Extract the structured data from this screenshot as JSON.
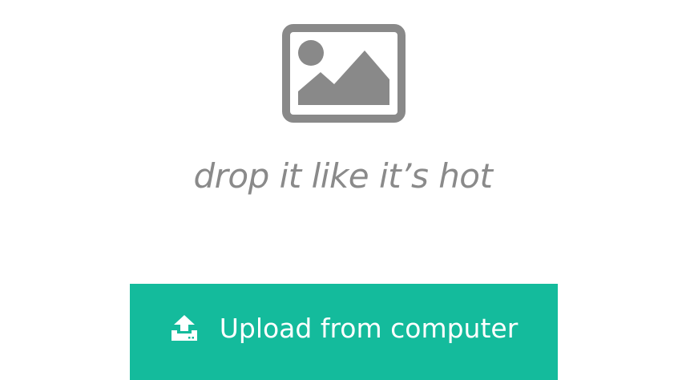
{
  "dropzone": {
    "icon": "image-placeholder-icon",
    "text": "drop it like it’s hot",
    "text_color": "#8a8a8a",
    "icon_color": "#898989"
  },
  "upload_button": {
    "label": "Upload from computer",
    "icon": "upload-icon",
    "background": "#14bb9c",
    "text_color": "#ffffff"
  }
}
